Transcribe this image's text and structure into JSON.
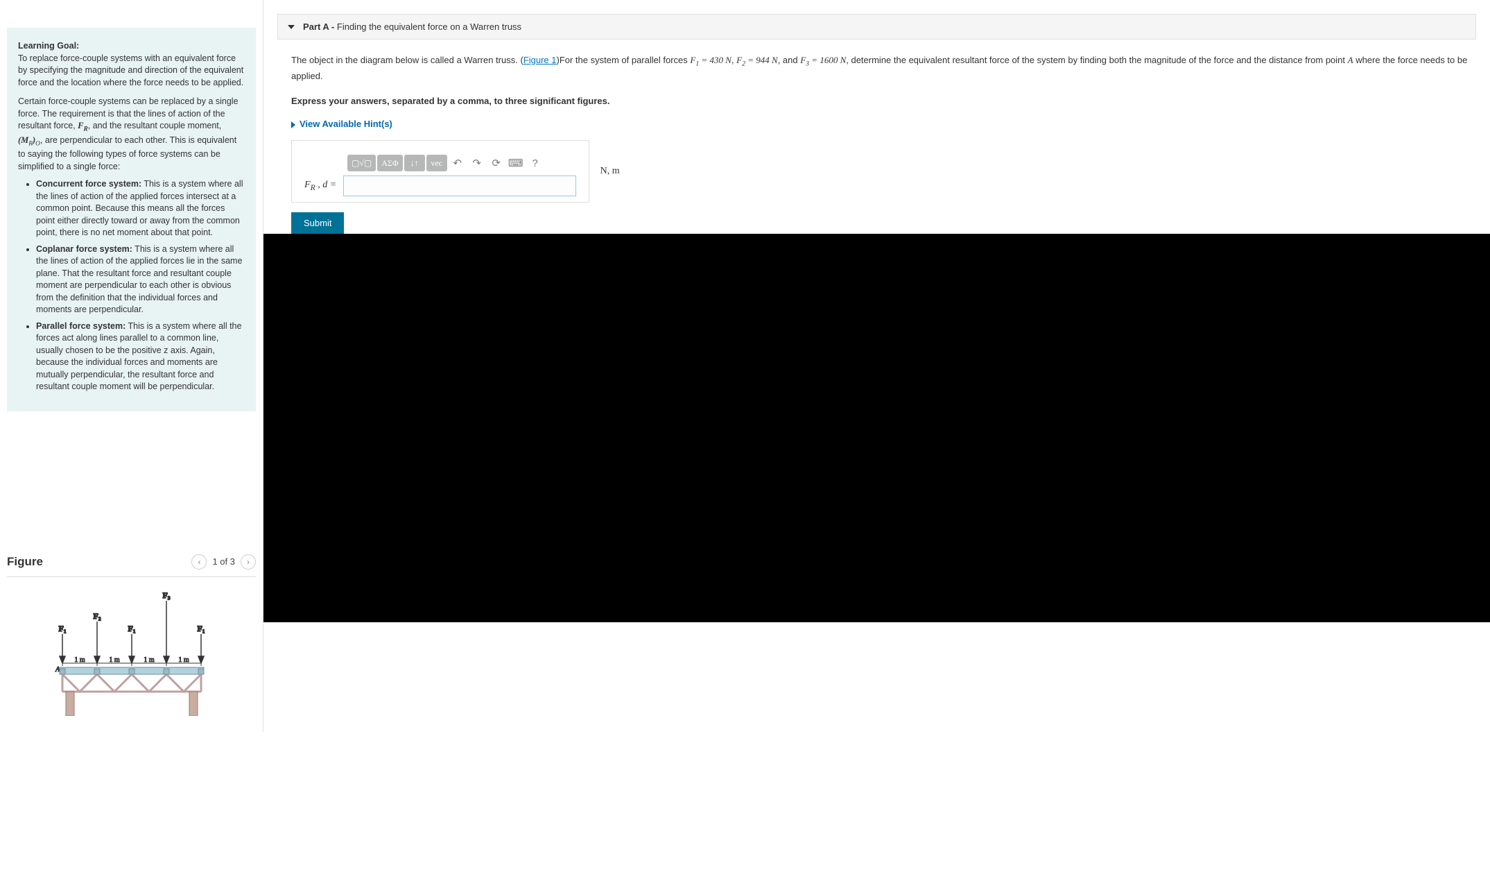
{
  "learning_goal": {
    "heading": "Learning Goal:",
    "intro": "To replace force-couple systems with an equivalent force by specifying the magnitude and direction of the equivalent force and the location where the force needs to be applied.",
    "para2_a": "Certain force-couple systems can be replaced by a single force. The requirement is that the lines of action of the resultant force, ",
    "para2_fr": "F",
    "para2_fr_sub": "R",
    "para2_b": ", and the resultant couple moment, ",
    "para2_mr": "(M",
    "para2_mr_sub": "R",
    "para2_mr_close": ")",
    "para2_o": "O",
    "para2_c": ", are perpendicular to each other. This is equivalent to saying the following types of force systems can be simplified to a single force:",
    "b1_title": "Concurrent force system:",
    "b1_text": " This is a system where all the lines of action of the applied forces intersect at a common point. Because this means all the forces point either directly toward or away from the common point, there is no net moment about that point.",
    "b2_title": "Coplanar force system:",
    "b2_text": " This is a system where all the lines of action of the applied forces lie in the same plane. That the resultant force and resultant couple moment are perpendicular to each other is obvious from the definition that the individual forces and moments are perpendicular.",
    "b3_title": "Parallel force system:",
    "b3_text": " This is a system where all the forces act along lines parallel to a common line, usually chosen to be the positive z axis. Again, because the individual forces and moments are mutually perpendicular, the resultant force and resultant couple moment will be perpendicular."
  },
  "figure": {
    "title": "Figure",
    "counter": "1 of 3",
    "labels": {
      "F1": "F₁",
      "F2": "F₂",
      "F3": "F₃",
      "dim": "1 m",
      "A": "A"
    }
  },
  "part": {
    "label": "Part A - ",
    "title": "Finding the equivalent force on a Warren truss",
    "prompt_a": "The object in the diagram below is called a Warren truss. (",
    "fig_link": "Figure 1",
    "prompt_b": ")For the system of parallel forces ",
    "f1": "F₁ = 430 N",
    "sep1": ", ",
    "f2": "F₂ = 944 N",
    "sep2": ", and ",
    "f3": "F₃ = 1600 N",
    "prompt_c": ", determine the equivalent resultant force of the system by finding both the magnitude of the force and the distance from point ",
    "pointA": "A",
    "prompt_d": " where the force needs to be applied.",
    "instruct": "Express your answers, separated by a comma, to three significant figures.",
    "hints": "View Available Hint(s)"
  },
  "answer": {
    "label": "F_R , d = ",
    "units": "N, m",
    "submit": "Submit",
    "tb": {
      "templates": "▢√▢",
      "greek": "ΑΣΦ",
      "subsup": "↓↑",
      "vec": "vec",
      "undo": "↶",
      "redo": "↷",
      "reset": "⟳",
      "keyboard": "⌨",
      "help": "?"
    }
  },
  "chart_data": {
    "type": "diagram",
    "description": "Warren truss with point A at left end. Five vertical downward forces applied along top chord at 1 m spacing.",
    "forces_sequence": [
      "F1",
      "F2",
      "F1",
      "F3",
      "F1"
    ],
    "spacing_m": 1,
    "span_segments": 4,
    "F1_N": 430,
    "F2_N": 944,
    "F3_N": 1600
  }
}
